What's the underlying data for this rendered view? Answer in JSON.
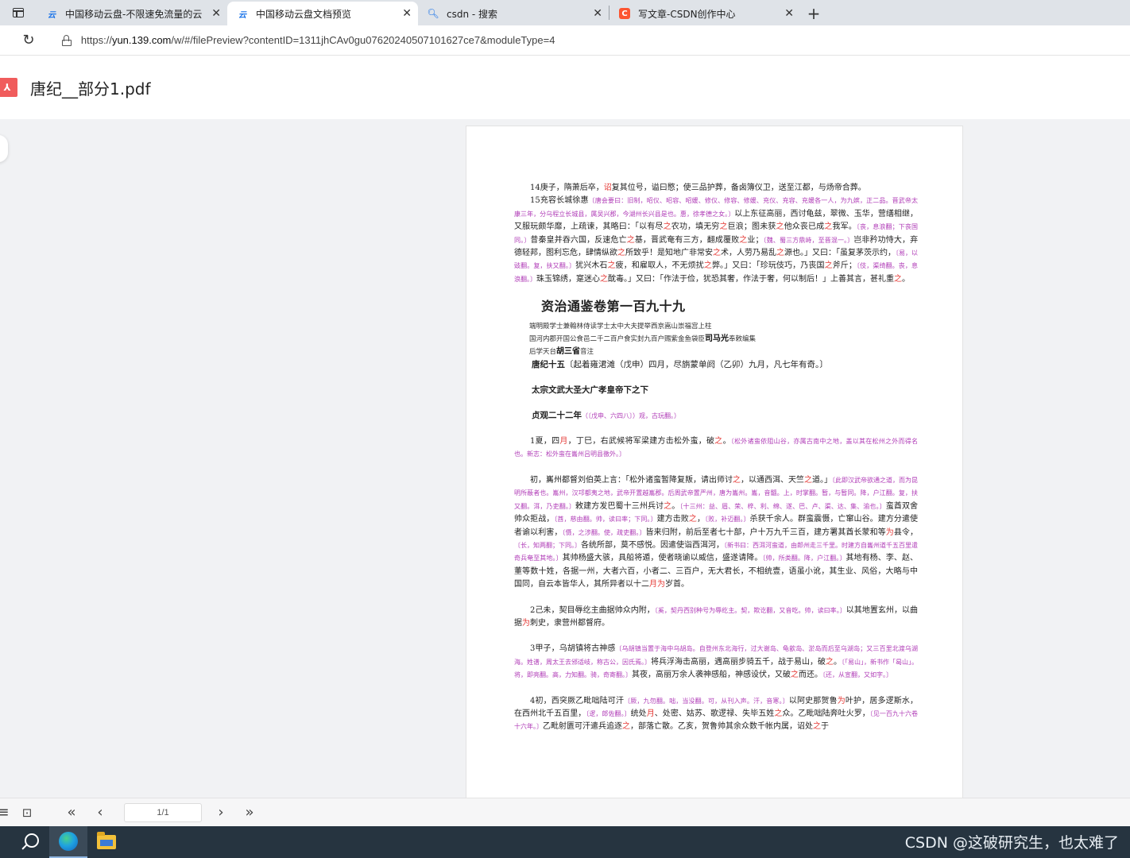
{
  "browser": {
    "tabs": [
      {
        "icon": "cloud-icon",
        "title": "中国移动云盘-不限速免流量的云",
        "active": false
      },
      {
        "icon": "cloud-icon",
        "title": "中国移动云盘文档预览",
        "active": true
      },
      {
        "icon": "search-icon",
        "title": "csdn - 搜索",
        "active": false
      },
      {
        "icon": "csdn-icon",
        "title": "写文章-CSDN创作中心",
        "active": false
      }
    ],
    "url_prefix": "https://",
    "url_host": "yun.139.com",
    "url_path": "/w/#/filePreview?contentID=1311jhCAv0gu07620240507101627ce7&moduleType=4"
  },
  "document": {
    "title": "唐纪__部分1.pdf"
  },
  "page": {
    "p14": "14庚子，隋萧后卒，",
    "p14_r1": "诏",
    "p14_b": "复其位号，谥曰愍；使三品护葬，备卤簿仪卫，送至江都，与炀帝合葬。",
    "p15_a": "15充容长城徐惠",
    "p15_m1": "〔唐会要曰：旧制，昭仪、昭容、昭媛、修仪、修容、修媛、充仪、充容、充媛各一人，为九嫔，正二品。晋武帝太康三年，分乌程立长城县，属吴兴郡，今湖州长兴县是也。惠，徐孝德之女。〕",
    "p15_b": "以上东征高丽，西讨龟兹，翠微、玉华，营缮相继，又服玩颇华靡，上疏谏，其略曰：「以有尽",
    "p15_r1": "之",
    "p15_c": "农功，填无穷",
    "p15_r2": "之",
    "p15_d": "巨浪；图未获",
    "p15_r3": "之",
    "p15_e": "他众丧已成",
    "p15_r4": "之",
    "p15_f": "我军。",
    "p15_m2": "〔丧，息浪翻；下丧国同。〕",
    "p15_g": "昔秦皇并吞六国，反速危亡",
    "p15_r5": "之",
    "p15_h": "基，晋武奄有三方，翻成覆败",
    "p15_r6": "之",
    "p15_i": "业；",
    "p15_m3": "〔魏、蜀三方鼎峙，至晋混一。〕",
    "p15_j": "岂非矜功恃大，弃德轻邦，图利忘危，肆情纵欲",
    "p15_r7": "之",
    "p15_k": "所致乎！是知地广非常安",
    "p15_r8": "之",
    "p15_l": "术，人劳乃易乱",
    "p15_r9": "之",
    "p15_n": "源也。」又曰：「虽复茅茨示约，",
    "p15_m4": "〔易，以豉翻。复，扶又翻。〕",
    "p15_o": "犹兴木石",
    "p15_r10": "之",
    "p15_p": "疲，和雇取人，不无烦扰",
    "p15_r11": "之",
    "p15_q": "弊。」又曰：「珍玩伎巧，乃丧国",
    "p15_r12": "之",
    "p15_s": "斧斤；",
    "p15_m5": "〔伎，渠绮翻。丧，息浪翻。〕",
    "p15_t": "珠玉锦绣，寔迷心",
    "p15_r13": "之",
    "p15_u": "酖毒。」又曰：「作法于俭，犹恐其奢，作法于奢，何以制后！」上善其言，甚礼重",
    "p15_r14": "之",
    "p15_v": "。",
    "vol_title": "资治通鉴卷第一百九十九",
    "meta1": "端明殿学士兼翰林侍读学士太中大夫提举西京嵩山崇福宫上柱",
    "meta2_a": "国河内郡开国公食邑二千二百户食实封九百户赐紫金鱼袋臣",
    "meta2_b": "司马光",
    "meta2_c": "奉敕编集",
    "meta3_a": "后学天台",
    "meta3_b": "胡三省",
    "meta3_c": "音注",
    "era_a": "唐纪十五",
    "era_b": "〔起着雍涒滩（戊申）四月，尽旃蒙单阏（乙卯）九月，凡七年有奇。〕",
    "section": "太宗文武大圣大广孝皇帝下之下",
    "year_a": "贞观二十二年",
    "year_m": "（〔戊申、六四八〕）观，古玩翻。）",
    "p1_a": "1夏，四",
    "p1_r1": "月",
    "p1_b": "，丁巳，右武候将军梁建方击松外蛮，破",
    "p1_r2": "之",
    "p1_c": "。",
    "p1_m": "〔松外诸蛮依阻山谷，亦属古南中之地，盖以其在松州之外而得名也。新志：松外蛮在巂州吕明县徼外。〕",
    "p1b_a": "初，巂州都督刘伯英上言：「松外诸蛮暂降复叛，请出师讨",
    "p1b_r1": "之",
    "p1b_b": "，以通西洱、天竺",
    "p1b_r2": "之",
    "p1b_c": "道。」",
    "p1b_m1": "〔此即汉武帝欲通之道，而为昆明所蔽者也。巂州，汉邛都夷之地，武帝开置越巂郡。后周武帝置严州，唐为巂州。巂，音髓。上，时掌翻。暂，与暂同。降，户江翻。复，扶又翻。洱，乃吏翻。〕",
    "p1b_d": "敕建方发巴蜀十三州兵讨",
    "p1b_r3": "之",
    "p1b_e": "。",
    "p1b_m2": "〔十三州：益、眉、荣、梓、利、绵、遂、巴、卢、渠、达、集、渝也。〕",
    "p1b_f": "蛮酋双舍帅众拒战，",
    "p1b_m3": "〔酋，慈由翻。帅，读曰率；下同。〕",
    "p1b_g": "建方击败",
    "p1b_r4": "之",
    "p1b_h": "，",
    "p1b_m4": "〔败，补迈翻。〕",
    "p1b_i": "杀获千余人。群蛮震慑，亡窜山谷。建方分遣使者谕以利害，",
    "p1b_m5": "〔慑，之涉翻。使，疏吏翻。〕",
    "p1b_j": "皆来归附，前后至者七十部，户十万九千三百，建方署其酋长蒙和等",
    "p1b_r5": "为",
    "p1b_k": "县令，",
    "p1b_m6": "〔长，知两翻；下同。〕",
    "p1b_l": "各统所部，莫不感悦。因遣使诣西洱河，",
    "p1b_m7": "〔新书曰：西洱河蛮道，由郎州走三千里。时建方自巂州道千五百里遣奇兵奄至其地。〕",
    "p1b_n": "其帅杨盛大骇，具船将遁，使者晓谕以威信，盛遂请降。",
    "p1b_m8": "〔帅，所类翻。降，户江翻。〕",
    "p1b_o": "其地有杨、李、赵、董等数十姓，各据一州，大者六百，小者二、三百户，无大君长，不相统壹，语虽小讹，其生业、风俗，大略与中国同，自云本皆华人，其所异者以十二",
    "p1b_r6": "月为",
    "p1b_p": "岁首。",
    "p2_a": "2己未，契目辱纥主曲据帅众内附，",
    "p2_m": "〔奚，契丹西别种号为辱纥主。契，欺讫翻，又音吃。帅，读曰率。〕",
    "p2_b": "以其地置玄州，以曲据",
    "p2_r1": "为",
    "p2_c": "刺史，隶营州都督府。",
    "p3_a": "3甲子，乌胡镇将古神感",
    "p3_m1": "〔乌胡镇当置于海中乌胡岛。自登州东北海行，过大谢岛、龟歆岛、淤岛而后至乌湖岛；又三百里北渡乌湖海。姓谱，周太王去邠适岐，称古公，因氏焉。〕",
    "p3_b": "将兵浮海击高丽，遇高丽步骑五千，战于易山，破",
    "p3_r1": "之",
    "p3_c": "。",
    "p3_m2": "〔「易山」，新书作「曷山」。将，即亮翻。高，力知翻。骑，奇寄翻。〕",
    "p3_d": "其夜，高丽万余人袭神感船，神感设伏，又破",
    "p3_r2": "之",
    "p3_e": "而还。",
    "p3_m3": "〔还，从宣翻，又如字。〕",
    "p4_a": "4初，西突厥乙毗咄陆可汗",
    "p4_m1": "〔厥，九勿翻。咄，当没翻。可，从刊入声。汗，音寒。〕",
    "p4_b": "以阿史那贺鲁",
    "p4_r1": "为",
    "p4_c": "叶护，居多逻斯水，在西州北千五百里，",
    "p4_m2": "〔逻，郎佐翻。〕",
    "p4_d": "统处",
    "p4_r2": "月",
    "p4_e": "、处密、姑苏、歌逻禄、失毕五姓",
    "p4_r3": "之",
    "p4_f": "众。乙毗咄陆奔吐火罗，",
    "p4_m3": "〔见一百九十六卷十六年。〕",
    "p4_g": "乙毗射匮可汗遣兵追逐",
    "p4_r4": "之",
    "p4_h": "，部落亡散。乙亥，贺鲁帅其余众数千帐内属，诏处",
    "p4_r5": "之",
    "p4_i": "于"
  },
  "toolbar": {
    "page_indicator": "1/1"
  },
  "taskbar": {
    "watermark": "CSDN @这破研究生，也太难了"
  }
}
